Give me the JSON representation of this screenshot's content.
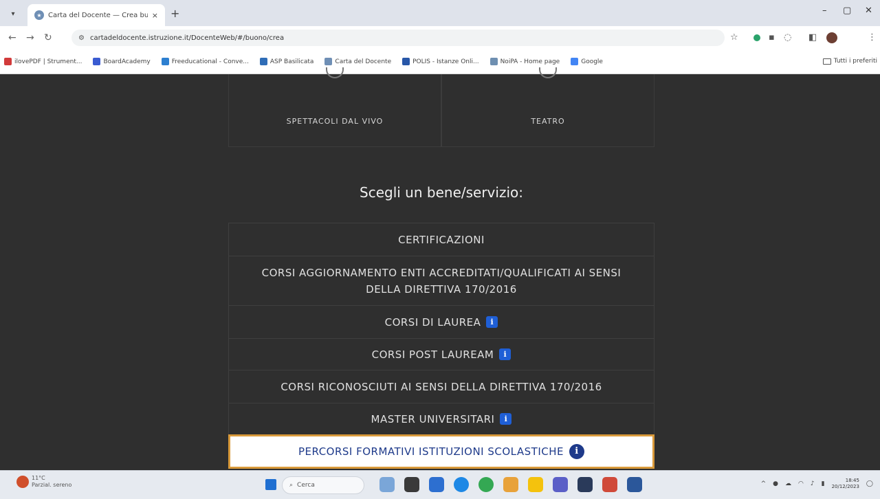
{
  "browser": {
    "tab_title": "Carta del Docente — Crea buo",
    "tab_close": "×",
    "new_tab": "+",
    "url": "cartadeldocente.istruzione.it/DocenteWeb/#/buono/crea",
    "bookmarks": [
      {
        "label": "ilovePDF | Strument...",
        "color": "#d23b3b"
      },
      {
        "label": "BoardAcademy",
        "color": "#3a5bd1"
      },
      {
        "label": "Freeducational - Conve...",
        "color": "#2d7fd0"
      },
      {
        "label": "ASP Basilicata",
        "color": "#2f6db7"
      },
      {
        "label": "Carta del Docente",
        "color": "#6f8fb5"
      },
      {
        "label": "POLIS - Istanze Onli...",
        "color": "#2857a8"
      },
      {
        "label": "NoiPA - Home page",
        "color": "#6e8fb1"
      },
      {
        "label": "Google",
        "color": "#4285f4"
      }
    ],
    "bookmarks_right": "Tutti i preferiti"
  },
  "categories": [
    {
      "label": "SPETTACOLI DAL VIVO"
    },
    {
      "label": "TEATRO"
    }
  ],
  "choose_title": "Scegli un bene/servizio:",
  "services": [
    {
      "label": "CERTIFICAZIONI",
      "info": false,
      "selected": false
    },
    {
      "label": "CORSI AGGIORNAMENTO ENTI ACCREDITATI/QUALIFICATI AI SENSI DELLA DIRETTIVA 170/2016",
      "info": false,
      "selected": false
    },
    {
      "label": "CORSI DI LAUREA",
      "info": true,
      "selected": false
    },
    {
      "label": "CORSI POST LAUREAM",
      "info": true,
      "selected": false
    },
    {
      "label": "CORSI RICONOSCIUTI AI SENSI DELLA DIRETTIVA 170/2016",
      "info": false,
      "selected": false
    },
    {
      "label": "MASTER UNIVERSITARI",
      "info": true,
      "selected": false
    },
    {
      "label": "PERCORSI FORMATIVI ISTITUZIONI SCOLASTICHE",
      "info": true,
      "selected": true
    }
  ],
  "info_glyph": "i",
  "taskbar": {
    "weather_temp": "11°C",
    "weather_desc": "Parzial. sereno",
    "search_placeholder": "Cerca",
    "time": "18:45",
    "date": "20/12/2023"
  }
}
